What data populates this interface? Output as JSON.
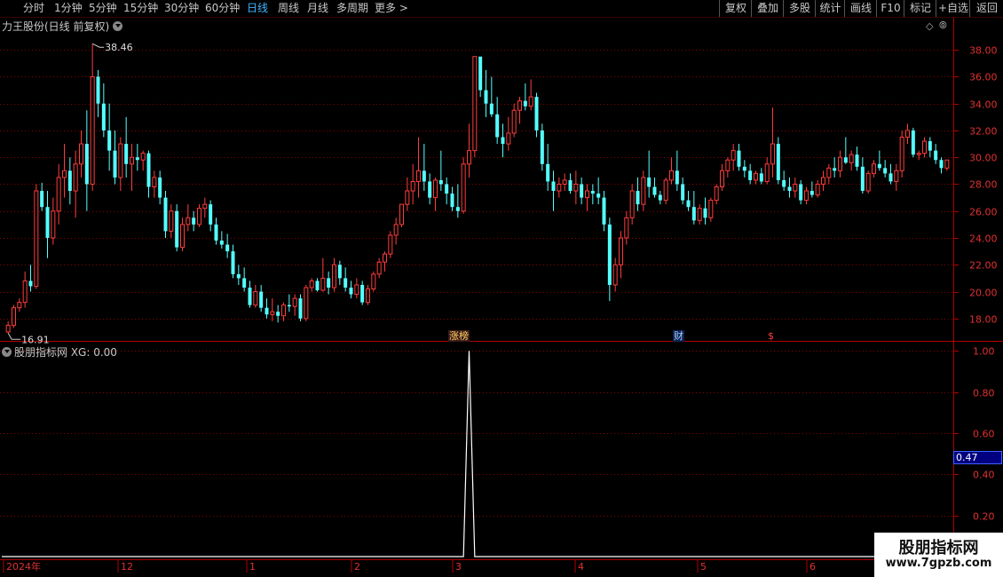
{
  "toolbar": {
    "periods": [
      "分时",
      "1分钟",
      "5分钟",
      "15分钟",
      "30分钟",
      "60分钟",
      "日线",
      "周线",
      "月线",
      "多周期",
      "更多 >"
    ],
    "active_period": "日线",
    "right_buttons": [
      "复权",
      "叠加",
      "多股",
      "统计",
      "画线",
      "F10",
      "标记",
      "+自选",
      "返回"
    ]
  },
  "main_panel": {
    "title": "力王股份(日线 前复权)",
    "high_label": "38.46",
    "low_label": "16.91",
    "markers": {
      "zhangbang": "涨榜",
      "cai": "财",
      "dollar": "$"
    }
  },
  "sub_panel": {
    "title": "股朋指标网 XG: 0.00",
    "current_value": "0.47"
  },
  "watermark": {
    "title": "股朋指标网",
    "url": "www.7gpzb.com"
  },
  "chart_data": [
    {
      "type": "candlestick",
      "title": "力王股份(日线 前复权)",
      "y_ticks": [
        "38.00",
        "36.00",
        "34.00",
        "32.00",
        "30.00",
        "28.00",
        "26.00",
        "24.00",
        "22.00",
        "20.00",
        "18.00"
      ],
      "ylim": [
        16.4,
        39.2
      ],
      "x_labels": [
        "2024年",
        "12",
        "1",
        "2",
        "3",
        "4",
        "5",
        "6"
      ],
      "up_color": "#ff3c3c",
      "down_color": "#54ffff",
      "ohlc": [
        [
          17.0,
          17.8,
          16.91,
          17.5
        ],
        [
          17.5,
          19.0,
          17.3,
          18.8
        ],
        [
          18.8,
          19.5,
          18.5,
          19.2
        ],
        [
          19.2,
          21.5,
          18.8,
          20.8
        ],
        [
          20.8,
          22.0,
          20.0,
          20.4
        ],
        [
          20.4,
          28.0,
          20.2,
          27.5
        ],
        [
          27.5,
          28.1,
          26.0,
          26.3
        ],
        [
          26.3,
          27.5,
          22.5,
          24.0
        ],
        [
          24.0,
          27.0,
          23.5,
          26.0
        ],
        [
          26.0,
          29.5,
          25.0,
          28.5
        ],
        [
          28.5,
          31.0,
          27.0,
          29.0
        ],
        [
          29.0,
          30.0,
          26.5,
          27.5
        ],
        [
          27.5,
          30.5,
          25.5,
          29.5
        ],
        [
          29.5,
          32.0,
          28.5,
          31.0
        ],
        [
          31.0,
          33.5,
          26.0,
          28.0
        ],
        [
          28.0,
          38.46,
          27.5,
          36.0
        ],
        [
          36.0,
          36.5,
          33.0,
          34.0
        ],
        [
          34.0,
          35.5,
          31.5,
          32.0
        ],
        [
          32.0,
          34.0,
          29.0,
          30.5
        ],
        [
          30.5,
          32.0,
          28.0,
          28.5
        ],
        [
          28.5,
          31.5,
          27.5,
          31.0
        ],
        [
          31.0,
          33.0,
          28.5,
          29.5
        ],
        [
          29.5,
          31.0,
          27.5,
          30.0
        ],
        [
          30.0,
          31.0,
          29.0,
          29.8
        ],
        [
          29.8,
          30.5,
          29.0,
          30.3
        ],
        [
          30.3,
          30.5,
          27.0,
          27.8
        ],
        [
          27.8,
          29.0,
          27.0,
          28.5
        ],
        [
          28.5,
          29.0,
          26.5,
          27.0
        ],
        [
          27.0,
          27.5,
          24.0,
          24.5
        ],
        [
          24.5,
          26.5,
          24.0,
          26.0
        ],
        [
          26.0,
          26.5,
          23.0,
          23.3
        ],
        [
          23.3,
          25.5,
          23.0,
          25.0
        ],
        [
          25.0,
          26.5,
          24.5,
          25.5
        ],
        [
          25.5,
          26.0,
          24.5,
          25.0
        ],
        [
          25.0,
          26.5,
          24.8,
          26.2
        ],
        [
          26.2,
          27.0,
          25.5,
          26.5
        ],
        [
          26.5,
          26.8,
          24.5,
          25.0
        ],
        [
          25.0,
          25.5,
          23.5,
          23.8
        ],
        [
          23.8,
          24.5,
          23.2,
          23.5
        ],
        [
          23.5,
          24.3,
          22.5,
          23.0
        ],
        [
          23.0,
          23.5,
          21.0,
          21.3
        ],
        [
          21.3,
          22.0,
          20.5,
          21.0
        ],
        [
          21.0,
          21.8,
          20.0,
          20.3
        ],
        [
          20.3,
          20.8,
          18.8,
          19.0
        ],
        [
          19.0,
          20.5,
          18.8,
          20.0
        ],
        [
          20.0,
          20.5,
          18.5,
          18.8
        ],
        [
          18.8,
          19.5,
          18.0,
          18.3
        ],
        [
          18.3,
          19.5,
          17.8,
          18.5
        ],
        [
          18.5,
          19.0,
          17.7,
          18.2
        ],
        [
          18.2,
          19.2,
          17.8,
          19.0
        ],
        [
          19.0,
          19.8,
          18.5,
          18.9
        ],
        [
          18.9,
          19.8,
          18.2,
          19.5
        ],
        [
          19.5,
          19.8,
          17.8,
          18.0
        ],
        [
          18.0,
          20.5,
          17.8,
          20.3
        ],
        [
          20.3,
          21.0,
          20.0,
          20.8
        ],
        [
          20.8,
          21.0,
          20.0,
          20.1
        ],
        [
          20.1,
          22.5,
          20.0,
          21.0
        ],
        [
          21.0,
          21.5,
          19.8,
          20.3
        ],
        [
          20.3,
          22.5,
          20.0,
          22.0
        ],
        [
          22.0,
          22.3,
          20.5,
          21.0
        ],
        [
          21.0,
          21.8,
          20.0,
          20.3
        ],
        [
          20.3,
          20.8,
          19.5,
          19.8
        ],
        [
          19.8,
          21.0,
          19.5,
          20.5
        ],
        [
          20.5,
          20.8,
          19.0,
          19.2
        ],
        [
          19.2,
          20.5,
          19.0,
          20.2
        ],
        [
          20.2,
          21.5,
          20.0,
          21.3
        ],
        [
          21.3,
          22.5,
          21.0,
          22.2
        ],
        [
          22.2,
          23.0,
          21.5,
          22.8
        ],
        [
          22.8,
          24.5,
          22.5,
          24.2
        ],
        [
          24.2,
          25.5,
          23.5,
          25.0
        ],
        [
          25.0,
          26.5,
          24.8,
          26.5
        ],
        [
          26.5,
          28.5,
          26.0,
          27.5
        ],
        [
          27.5,
          29.5,
          26.5,
          28.2
        ],
        [
          28.2,
          31.5,
          27.0,
          29.0
        ],
        [
          29.0,
          31.0,
          27.5,
          28.2
        ],
        [
          28.2,
          28.8,
          26.5,
          27.0
        ],
        [
          27.0,
          28.5,
          26.0,
          28.3
        ],
        [
          28.3,
          30.5,
          27.5,
          28.0
        ],
        [
          28.0,
          28.5,
          26.5,
          27.3
        ],
        [
          27.3,
          27.8,
          26.0,
          26.3
        ],
        [
          26.3,
          28.0,
          25.5,
          26.0
        ],
        [
          26.0,
          30.0,
          25.8,
          29.5
        ],
        [
          29.5,
          32.5,
          28.5,
          30.5
        ],
        [
          30.5,
          37.5,
          30.0,
          37.5
        ],
        [
          37.5,
          37.0,
          34.5,
          35.0
        ],
        [
          35.0,
          36.5,
          33.0,
          34.0
        ],
        [
          34.0,
          36.0,
          33.0,
          33.2
        ],
        [
          33.2,
          34.5,
          31.0,
          31.5
        ],
        [
          31.5,
          32.5,
          30.0,
          31.0
        ],
        [
          31.0,
          33.0,
          30.5,
          31.8
        ],
        [
          31.8,
          34.0,
          31.5,
          33.5
        ],
        [
          33.5,
          34.5,
          32.5,
          34.2
        ],
        [
          34.2,
          35.5,
          33.5,
          33.8
        ],
        [
          33.8,
          35.8,
          33.5,
          34.5
        ],
        [
          34.5,
          34.8,
          31.5,
          32.0
        ],
        [
          32.0,
          32.5,
          29.0,
          29.5
        ],
        [
          29.5,
          31.0,
          27.5,
          28.2
        ],
        [
          28.2,
          29.0,
          26.0,
          27.5
        ],
        [
          27.5,
          28.5,
          27.0,
          28.0
        ],
        [
          28.0,
          28.8,
          27.5,
          28.3
        ],
        [
          28.3,
          28.8,
          27.3,
          27.5
        ],
        [
          27.5,
          29.0,
          26.5,
          28.0
        ],
        [
          28.0,
          28.5,
          26.5,
          27.0
        ],
        [
          27.0,
          28.0,
          26.0,
          27.5
        ],
        [
          27.5,
          28.0,
          26.5,
          27.3
        ],
        [
          27.3,
          28.5,
          26.5,
          27.0
        ],
        [
          27.0,
          27.5,
          24.5,
          25.0
        ],
        [
          25.0,
          25.5,
          19.3,
          20.5
        ],
        [
          20.5,
          22.5,
          20.0,
          22.0
        ],
        [
          22.0,
          24.5,
          21.0,
          24.0
        ],
        [
          24.0,
          26.0,
          23.5,
          25.5
        ],
        [
          25.5,
          28.0,
          25.0,
          27.5
        ],
        [
          27.5,
          28.5,
          26.0,
          26.5
        ],
        [
          26.5,
          29.0,
          26.0,
          28.5
        ],
        [
          28.5,
          30.5,
          27.0,
          27.8
        ],
        [
          27.8,
          28.5,
          27.0,
          27.2
        ],
        [
          27.2,
          27.5,
          26.5,
          26.8
        ],
        [
          26.8,
          28.5,
          26.5,
          28.3
        ],
        [
          28.3,
          30.0,
          28.0,
          29.0
        ],
        [
          29.0,
          30.5,
          27.5,
          28.0
        ],
        [
          28.0,
          28.5,
          26.5,
          26.8
        ],
        [
          26.8,
          27.5,
          26.0,
          26.3
        ],
        [
          26.3,
          27.5,
          25.0,
          25.3
        ],
        [
          25.3,
          26.5,
          25.0,
          26.2
        ],
        [
          26.2,
          27.0,
          25.0,
          25.5
        ],
        [
          25.5,
          27.0,
          25.2,
          26.8
        ],
        [
          26.8,
          28.0,
          26.5,
          27.8
        ],
        [
          27.8,
          29.5,
          27.5,
          29.0
        ],
        [
          29.0,
          30.0,
          28.5,
          29.8
        ],
        [
          29.8,
          31.0,
          29.0,
          30.5
        ],
        [
          30.5,
          31.0,
          29.0,
          29.3
        ],
        [
          29.3,
          29.8,
          28.5,
          29.0
        ],
        [
          29.0,
          29.5,
          28.0,
          28.3
        ],
        [
          28.3,
          29.0,
          28.0,
          28.8
        ],
        [
          28.8,
          29.2,
          28.0,
          28.2
        ],
        [
          28.2,
          30.0,
          28.0,
          29.5
        ],
        [
          29.5,
          33.7,
          28.5,
          31.0
        ],
        [
          31.0,
          31.5,
          28.0,
          28.3
        ],
        [
          28.3,
          29.0,
          27.5,
          27.8
        ],
        [
          27.8,
          28.5,
          27.0,
          27.5
        ],
        [
          27.5,
          28.5,
          27.0,
          28.0
        ],
        [
          28.0,
          28.3,
          26.5,
          26.8
        ],
        [
          26.8,
          27.8,
          26.5,
          27.5
        ],
        [
          27.5,
          28.2,
          27.0,
          27.2
        ],
        [
          27.2,
          28.3,
          27.0,
          28.0
        ],
        [
          28.0,
          29.0,
          27.5,
          28.5
        ],
        [
          28.5,
          29.5,
          28.0,
          29.2
        ],
        [
          29.2,
          30.0,
          28.5,
          29.0
        ],
        [
          29.0,
          30.5,
          28.5,
          30.0
        ],
        [
          30.0,
          31.5,
          29.5,
          29.6
        ],
        [
          29.6,
          30.5,
          29.0,
          30.2
        ],
        [
          30.2,
          30.8,
          29.0,
          29.3
        ],
        [
          29.3,
          30.0,
          27.3,
          27.5
        ],
        [
          27.5,
          29.0,
          27.3,
          28.8
        ],
        [
          28.8,
          29.8,
          28.5,
          29.5
        ],
        [
          29.5,
          30.5,
          29.0,
          29.2
        ],
        [
          29.2,
          29.8,
          28.5,
          28.8
        ],
        [
          28.8,
          29.5,
          28.0,
          28.2
        ],
        [
          28.2,
          29.5,
          27.5,
          29.0
        ],
        [
          29.0,
          32.0,
          28.5,
          31.5
        ],
        [
          31.5,
          32.5,
          31.0,
          32.0
        ],
        [
          32.0,
          32.2,
          30.0,
          30.2
        ],
        [
          30.2,
          30.5,
          29.8,
          30.3
        ],
        [
          30.3,
          31.5,
          30.0,
          31.2
        ],
        [
          31.2,
          31.5,
          30.0,
          30.5
        ],
        [
          30.5,
          31.0,
          29.5,
          29.8
        ],
        [
          29.8,
          30.0,
          28.8,
          29.2
        ],
        [
          29.2,
          29.8,
          29.0,
          29.8
        ]
      ]
    },
    {
      "type": "line",
      "title": "股朋指标网 XG: 0.00",
      "y_ticks": [
        "1.00",
        "0.80",
        "0.60",
        "0.40",
        "0.20"
      ],
      "ylim": [
        0,
        1.04
      ],
      "line_color": "#ffffff",
      "series": [
        {
          "values_spike_index": 82,
          "values": "zero except spike"
        }
      ],
      "spike_index": 82,
      "spike_value": 1.0
    }
  ]
}
